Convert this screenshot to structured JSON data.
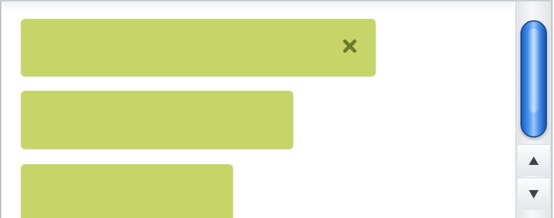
{
  "list": {
    "items": [
      {
        "has_close": true,
        "close_glyph": "×"
      },
      {
        "has_close": false
      },
      {
        "has_close": false
      }
    ]
  },
  "colors": {
    "item_fill": "#c6d468",
    "close_x": "#6b7a2e",
    "thumb_blue": "#4f95ec"
  },
  "icons": {
    "close": "close-x-icon",
    "scroll_up": "triangle-up-icon",
    "scroll_down": "triangle-down-icon"
  }
}
